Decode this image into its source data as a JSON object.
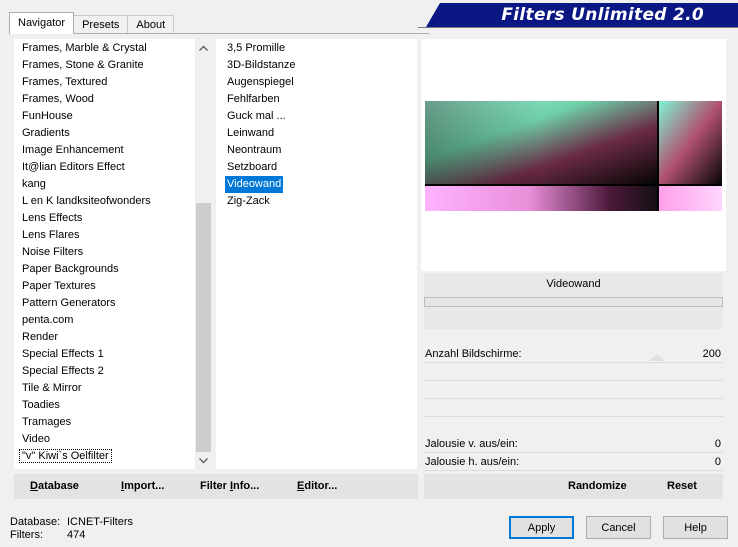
{
  "window": {
    "title": "Filters Unlimited 2.0"
  },
  "tabs": [
    {
      "label": "Navigator",
      "active": true
    },
    {
      "label": "Presets",
      "active": false
    },
    {
      "label": "About",
      "active": false
    }
  ],
  "categories": {
    "items": [
      "Frames, Marble & Crystal",
      "Frames, Stone & Granite",
      "Frames, Textured",
      "Frames, Wood",
      "FunHouse",
      "Gradients",
      "Image Enhancement",
      "It@lian Editors Effect",
      "kang",
      "L en K landksiteofwonders",
      "Lens Effects",
      "Lens Flares",
      "Noise Filters",
      "Paper Backgrounds",
      "Paper Textures",
      "Pattern Generators",
      "penta.com",
      "Render",
      "Special Effects 1",
      "Special Effects 2",
      "Tile & Mirror",
      "Toadies",
      "Tramages",
      "Video",
      "\"v\" Kiwi`s Oelfilter"
    ],
    "focused_index": 24,
    "scroll_up_icon": "chevron-up",
    "scroll_down_icon": "chevron-down"
  },
  "filters": {
    "items": [
      "3,5 Promille",
      "3D-Bildstanze",
      "Augenspiegel",
      "Fehlfarben",
      "Guck mal ...",
      "Leinwand",
      "Neontraum",
      "Setzboard",
      "Videowand",
      "Zig-Zack"
    ],
    "selected_index": 8
  },
  "preview": {
    "filter_name": "Videowand"
  },
  "parameters": [
    {
      "label": "Anzahl Bildschirme:",
      "value": "200"
    },
    {
      "label": "Jalousie v. aus/ein:",
      "value": "0"
    },
    {
      "label": "Jalousie h. aus/ein:",
      "value": "0"
    }
  ],
  "left_bar": {
    "database_u": "D",
    "database_rest": "atabase",
    "import_u": "I",
    "import_rest": "mport...",
    "filterinfo_pre": "Filter ",
    "filterinfo_u": "I",
    "filterinfo_rest": "nfo...",
    "editor_u": "E",
    "editor_rest": "ditor..."
  },
  "right_bar": {
    "randomize_label": "Randomize",
    "reset_label": "Reset"
  },
  "status": {
    "database_key": "Database:",
    "database_value": "ICNET-Filters",
    "filters_key": "Filters:",
    "filters_value": "474"
  },
  "buttons": {
    "apply": "Apply",
    "cancel": "Cancel",
    "help": "Help"
  },
  "colors": {
    "banner": "#0b1782",
    "selection": "#0078d7"
  }
}
